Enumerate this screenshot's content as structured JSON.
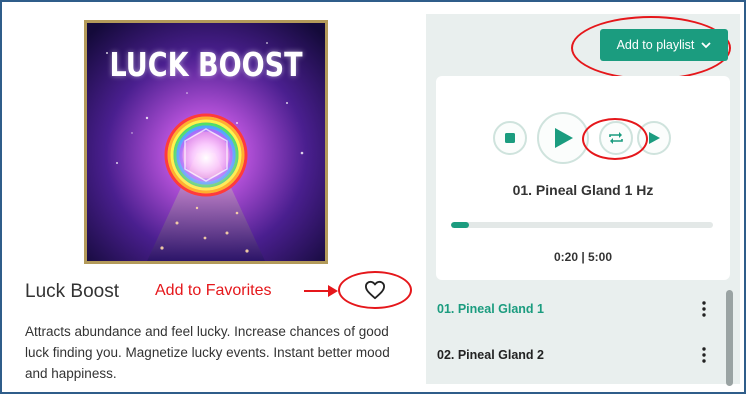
{
  "album": {
    "cover_title": "LUCK BOOST",
    "name": "Luck Boost",
    "favorites_annotation": "Add to Favorites",
    "description": "Attracts abundance and feel lucky. Increase chances of good luck finding you. Magnetize lucky events. Instant better mood and happiness."
  },
  "toolbar": {
    "add_to_playlist_label": "Add to playlist"
  },
  "player": {
    "now_playing": "01. Pineal Gland 1 Hz",
    "elapsed": "0:20",
    "duration": "5:00",
    "time_display": "0:20 | 5:00",
    "progress_fraction": 0.067
  },
  "tracks": [
    {
      "label": "01. Pineal Gland 1",
      "active": true
    },
    {
      "label": "02. Pineal Gland 2",
      "active": false
    }
  ],
  "colors": {
    "accent": "#1b9c7f",
    "annotation": "#e5171b",
    "panel_bg": "#e9efee"
  },
  "icons": {
    "favorite": "heart-outline-icon",
    "dropdown": "chevron-down-icon",
    "stop": "stop-icon",
    "play": "play-icon",
    "repeat": "repeat-icon",
    "next": "next-icon",
    "more": "kebab-menu-icon"
  }
}
